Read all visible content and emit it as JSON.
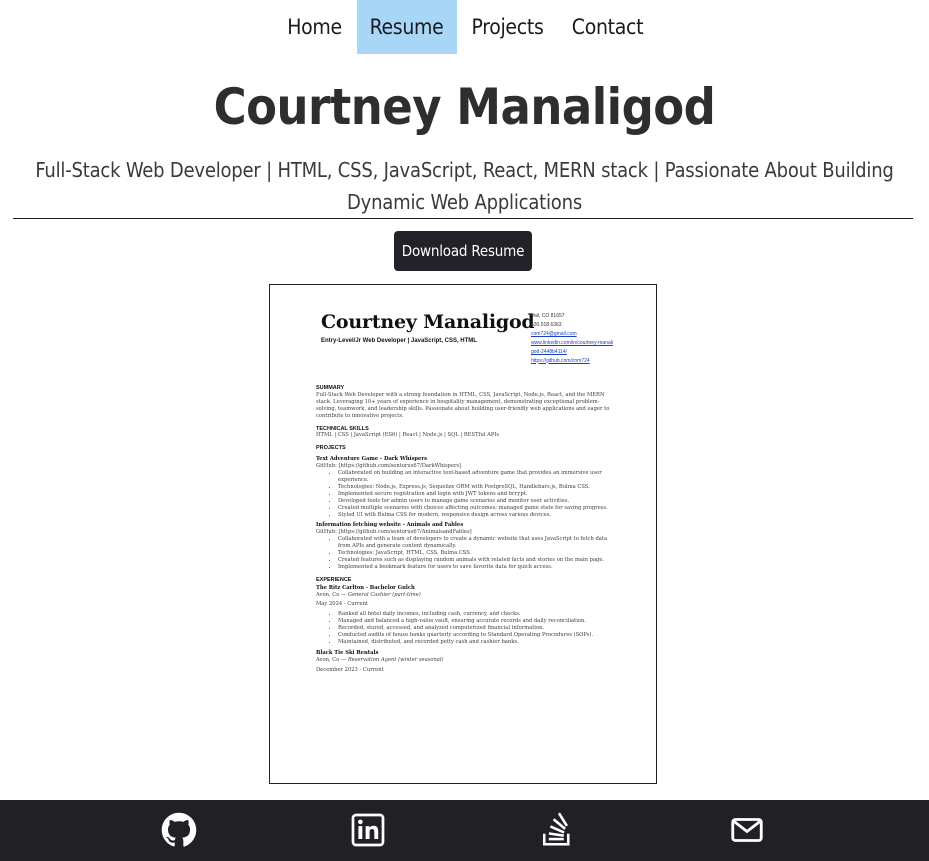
{
  "nav": {
    "items": [
      {
        "label": "Home"
      },
      {
        "label": "Resume"
      },
      {
        "label": "Projects"
      },
      {
        "label": "Contact"
      }
    ],
    "active": "Resume"
  },
  "header": {
    "name": "Courtney Manaligod",
    "tagline": "Full-Stack Web Developer | HTML, CSS, JavaScript, React, MERN stack | Passionate About Building Dynamic Web Applications"
  },
  "download_button": "Download Resume",
  "resume": {
    "name": "Courtney Manaligod",
    "subtitle": "Entry-Level/Jr Web Developer | JavaScript, CSS, HTML",
    "contact": {
      "location": "Vail, CO 81657",
      "phone": "630.518.6363",
      "email": "cnm724@gmail.com",
      "linkedin_1": "www.linkedin.com/in/courtney-manali",
      "linkedin_2": "god-2448b4114/",
      "github": "https://github.com/cnm724"
    },
    "summary_heading": "SUMMARY",
    "summary": "Full-Stack Web Developer with a strong foundation in HTML, CSS, JavaScript, Node.js, React, and the MERN stack. Leveraging 10+ years of experience in hospitality management, demonstrating exceptional problem-solving, teamwork, and leadership skills. Passionate about building user-friendly web applications and eager to contribute to innovative projects.",
    "skills_heading": "TECHNICAL SKILLS",
    "skills": "HTML | CSS | JavaScript (ES6) | React | Node.js | SQL | RESTful APIs",
    "projects_heading": "PROJECTS",
    "project1_title": "Text Adventure Game - Dark Whispers",
    "project1_link": "GitHub: [https://github.com/sentorus67/DarkWhispers]",
    "project1_bullets": [
      "Collaborated on building an interactive text-based adventure game that provides an immersive user experience.",
      "Technologies: Node.js, Express.js, Sequelize ORM with PostgreSQL, Handlebars.js, Bulma CSS.",
      "Implemented secure registration and login with JWT tokens and bcrypt.",
      "Developed tools for admin users to manage game scenarios and monitor user activities.",
      "Created multiple scenarios with choices affecting outcomes; managed game state for saving progress.",
      "Styled UI with Bulma CSS for modern, responsive design across various devices."
    ],
    "project2_title": "Information fetching website - Animals and Fables",
    "project2_link": "GitHub: [https://github.com/sentorus67/AnimalsandFables]",
    "project2_bullets": [
      "Collaborated with a team of developers to create a dynamic website that uses JavaScript to fetch data from APIs and generate content dynamically.",
      "Technologies: JavaScript, HTML, CSS, Bulma CSS.",
      "Created features such as displaying random animals with related facts and stories on the main page.",
      "Implemented a bookmark feature for users to save favorite data for quick access."
    ],
    "experience_heading": "EXPERIENCE",
    "job1_title": "The Ritz Carlton - Bachelor Gulch",
    "job1_place": "Avon, Co — ",
    "job1_role": "General Cashier (part-time)",
    "job1_dates": "May 2024 - Current",
    "job1_bullets": [
      "Ranked all hotel daily incomes, including cash, currency, and checks.",
      "Managed and balanced a high-value vault, ensuring accurate records and daily reconciliation.",
      "Recorded, stored, accessed, and analyzed computerized financial information.",
      "Conducted audits of house banks quarterly according to Standard Operating Procedures (SOPs).",
      "Maintained, distributed, and recorded petty cash and cashier banks."
    ],
    "job2_title": "Black Tie Ski Rentals",
    "job2_place": "Avon, Co — ",
    "job2_role": "Reservation Agent (winter seasonal)",
    "job2_dates": "December 2023 - Current"
  },
  "footer": {
    "icons": [
      "github-icon",
      "linkedin-icon",
      "stack-overflow-icon",
      "email-icon"
    ]
  },
  "colors": {
    "active_nav": "#a7d6f7",
    "button_bg": "#222228",
    "footer_bg": "#212125"
  }
}
